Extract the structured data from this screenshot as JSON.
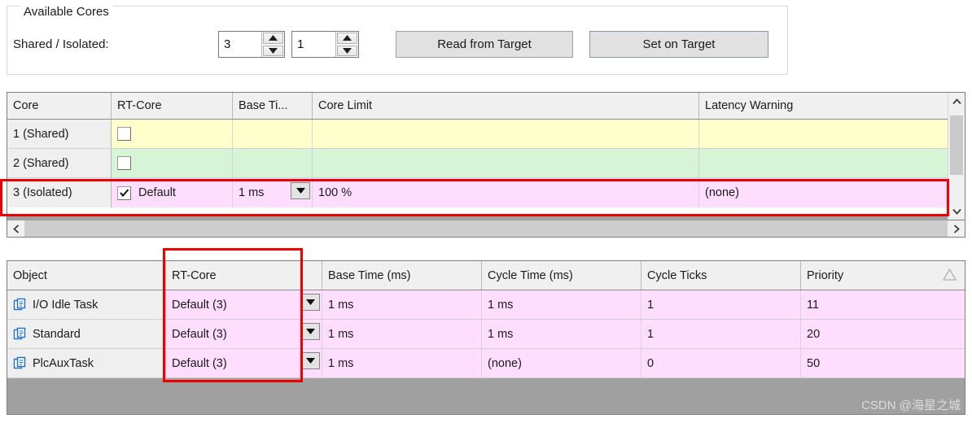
{
  "group": {
    "title": "Available Cores",
    "field_label": "Shared / Isolated:",
    "shared_value": "3",
    "isolated_value": "1",
    "read_button": "Read from Target",
    "set_button": "Set on Target"
  },
  "cores_grid": {
    "headers": [
      "Core",
      "RT-Core",
      "Base Ti...",
      "Core Limit",
      "Latency Warning"
    ],
    "rows": [
      {
        "core": "1 (Shared)",
        "rt_core": "",
        "base_time": "",
        "core_limit": "",
        "latency_warning": "",
        "checked": false,
        "tint": "tint-yellow",
        "has_dropdown": false
      },
      {
        "core": "2 (Shared)",
        "rt_core": "",
        "base_time": "",
        "core_limit": "",
        "latency_warning": "",
        "checked": false,
        "tint": "tint-green",
        "has_dropdown": false
      },
      {
        "core": "3 (Isolated)",
        "rt_core": "Default",
        "base_time": "1 ms",
        "core_limit": "100 %",
        "latency_warning": "(none)",
        "checked": true,
        "tint": "tint-pink",
        "has_dropdown": true
      }
    ]
  },
  "tasks_grid": {
    "headers": [
      "Object",
      "RT-Core",
      "Base Time (ms)",
      "Cycle Time (ms)",
      "Cycle Ticks",
      "Priority"
    ],
    "sort_indicator": "ascending-triangle",
    "rows": [
      {
        "object": "I/O Idle Task",
        "rt_core": "Default (3)",
        "base_time": "1 ms",
        "cycle_time": "1 ms",
        "cycle_ticks": "1",
        "priority": "11"
      },
      {
        "object": "Standard",
        "rt_core": "Default (3)",
        "base_time": "1 ms",
        "cycle_time": "1 ms",
        "cycle_ticks": "1",
        "priority": "20"
      },
      {
        "object": "PlcAuxTask",
        "rt_core": "Default (3)",
        "base_time": "1 ms",
        "cycle_time": "(none)",
        "cycle_ticks": "0",
        "priority": "50"
      }
    ]
  },
  "icons": {
    "spin_up": "spin-up-icon",
    "spin_down": "spin-down-icon",
    "dropdown": "chevron-down-icon",
    "scroll_up": "scroll-up-icon",
    "scroll_down": "scroll-down-icon",
    "scroll_left": "scroll-left-icon",
    "scroll_right": "scroll-right-icon",
    "object": "task-object-icon",
    "checkmark": "checkmark-icon"
  },
  "colors": {
    "row_shared_1": "#ffffcc",
    "row_shared_2": "#d6f5d6",
    "row_isolated": "#ffddff",
    "highlight": "#ee0000",
    "header_bg": "#f0f0f0"
  },
  "watermark": "CSDN @海星之城"
}
